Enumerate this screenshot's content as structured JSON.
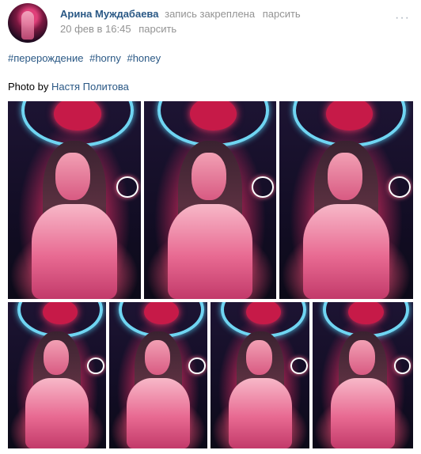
{
  "post": {
    "author": "Арина Муждабаева",
    "action": "запись закреплена",
    "repost_label": "парсить",
    "date": "20 фев в 16:45",
    "date_repost_label": "парсить",
    "menu": "···",
    "hashtags": [
      "#перерождение",
      "#horny",
      "#honey"
    ],
    "credit_prefix": "Photo by",
    "credit_name": "Настя Политова"
  },
  "icons": {
    "avatar": "user-avatar",
    "menu": "more-icon"
  },
  "colors": {
    "link": "#2a5885",
    "muted": "#939393"
  },
  "gallery": {
    "count": 7
  }
}
